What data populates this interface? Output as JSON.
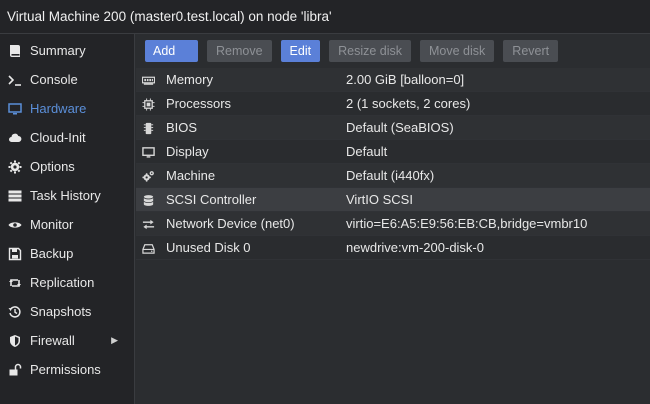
{
  "window": {
    "title": "Virtual Machine 200 (master0.test.local) on node 'libra'"
  },
  "sidebar": {
    "items": [
      {
        "label": "Summary",
        "icon": "book-icon"
      },
      {
        "label": "Console",
        "icon": "terminal-icon"
      },
      {
        "label": "Hardware",
        "icon": "monitor-icon",
        "active": true
      },
      {
        "label": "Cloud-Init",
        "icon": "cloud-icon"
      },
      {
        "label": "Options",
        "icon": "gear-icon"
      },
      {
        "label": "Task History",
        "icon": "list-icon"
      },
      {
        "label": "Monitor",
        "icon": "eye-icon"
      },
      {
        "label": "Backup",
        "icon": "floppy-icon"
      },
      {
        "label": "Replication",
        "icon": "retweet-icon"
      },
      {
        "label": "Snapshots",
        "icon": "history-icon"
      },
      {
        "label": "Firewall",
        "icon": "shield-icon",
        "arrow": "▶"
      },
      {
        "label": "Permissions",
        "icon": "unlock-icon"
      }
    ]
  },
  "toolbar": {
    "add_label": "Add",
    "remove_label": "Remove",
    "edit_label": "Edit",
    "resize_label": "Resize disk",
    "move_label": "Move disk",
    "revert_label": "Revert"
  },
  "hardware": {
    "rows": [
      {
        "name": "Memory",
        "value": "2.00 GiB [balloon=0]",
        "icon": "memory-icon"
      },
      {
        "name": "Processors",
        "value": "2 (1 sockets, 2 cores)",
        "icon": "cpu-icon"
      },
      {
        "name": "BIOS",
        "value": "Default (SeaBIOS)",
        "icon": "chip-icon"
      },
      {
        "name": "Display",
        "value": "Default",
        "icon": "display-icon"
      },
      {
        "name": "Machine",
        "value": "Default (i440fx)",
        "icon": "cogs-icon"
      },
      {
        "name": "SCSI Controller",
        "value": "VirtIO SCSI",
        "icon": "database-icon",
        "selected": true
      },
      {
        "name": "Network Device (net0)",
        "value": "virtio=E6:A5:E9:56:EB:CB,bridge=vmbr10",
        "icon": "exchange-icon"
      },
      {
        "name": "Unused Disk 0",
        "value": "newdrive:vm-200-disk-0",
        "icon": "hdd-icon"
      }
    ]
  },
  "colors": {
    "accent": "#5b80d8",
    "active_nav": "#5b8fd9",
    "background": "#2b2d30"
  }
}
